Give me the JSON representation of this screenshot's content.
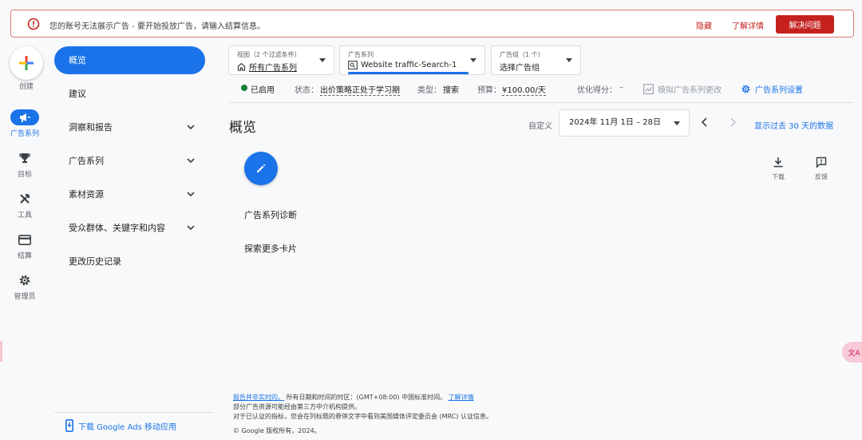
{
  "alert": {
    "message": "您的账号无法展示广告 - 要开始投放广告，请输入结算信息。",
    "hide": "隐藏",
    "learn_more": "了解详情",
    "fix": "解决问题",
    "color": "#c5221f"
  },
  "rail": {
    "create": "创建",
    "items": [
      {
        "label": "广告系列",
        "icon": "megaphone-icon",
        "active": true
      },
      {
        "label": "目标",
        "icon": "trophy-icon"
      },
      {
        "label": "工具",
        "icon": "tools-icon"
      },
      {
        "label": "结算",
        "icon": "credit-card-icon"
      },
      {
        "label": "管理员",
        "icon": "gear-icon"
      }
    ]
  },
  "nav": {
    "items": [
      {
        "label": "概览",
        "active": true
      },
      {
        "label": "建议"
      },
      {
        "label": "洞察和报告",
        "expandable": true
      },
      {
        "label": "广告系列",
        "expandable": true
      },
      {
        "label": "素材资源",
        "expandable": true
      },
      {
        "label": "受众群体、关键字和内容",
        "expandable": true
      },
      {
        "label": "更改历史记录"
      }
    ],
    "app_link": "下载 Google Ads 移动应用"
  },
  "selectors": {
    "view": {
      "small": "视图（2 个过滤条件）",
      "value": "所有广告系列"
    },
    "campaign": {
      "small": "广告系列",
      "value": "Website traffic-Search-1"
    },
    "adgroup": {
      "small": "广告组（1 个）",
      "value": "选择广告组"
    }
  },
  "status": {
    "enabled": "已启用",
    "status_label": "状态：",
    "status_value": "出价策略正处于学习期",
    "type_label": "类型：",
    "type_value": "搜索",
    "budget_label": "预算：",
    "budget_value": "¥100.00/天",
    "score_label": "优化得分：",
    "score_value": "–",
    "simulate": "模拟广告系列更改",
    "settings": "广告系列设置",
    "enabled_color": "#188038"
  },
  "page": {
    "title": "概览",
    "custom": "自定义",
    "date_range": "2024年 11月 1日 – 28日",
    "show_last": "显示过去 30 天的数据",
    "download": "下载",
    "feedback": "反馈",
    "card_diagnosis": "广告系列诊断",
    "card_more": "探索更多卡片"
  },
  "footer": {
    "line1_link": "报告并非实时的。",
    "line1_text": "所有日期和时间的时区：(GMT+08:00) 中国标准时间。",
    "line1_learn": "了解详情",
    "line2": "部分广告资源可能经由第三方中介机构提供。",
    "line3": "对于已认证的指标，您会在列标题的悬停文字中看到美国媒体评定委员会 (MRC) 认证信息。",
    "copyright": "© Google 版权所有，2024。"
  },
  "colors": {
    "accent": "#1a73e8",
    "background": "#f8f9fa"
  }
}
